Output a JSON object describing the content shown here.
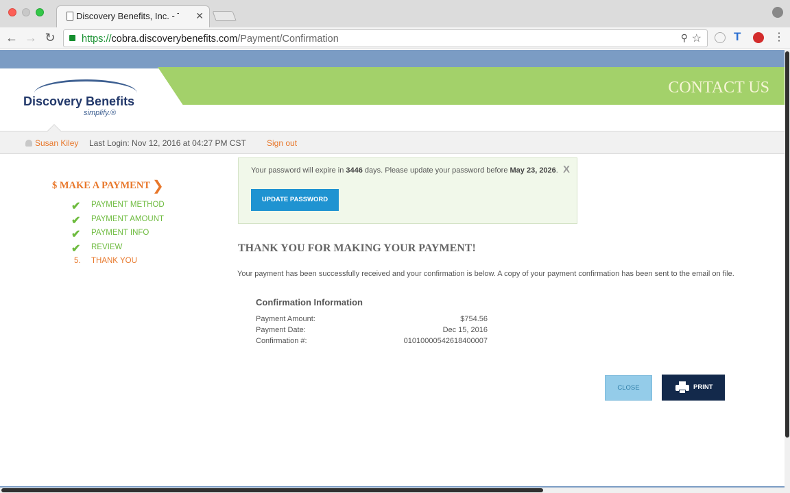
{
  "browser": {
    "tab_title": "Discovery Benefits, Inc. - Thank",
    "tab_close": "✕",
    "url_scheme": "https://",
    "url_host": "cobra.discoverybenefits.com",
    "url_path": "/Payment/Confirmation",
    "back_icon": "←",
    "forward_icon": "→",
    "reload_icon": "↻",
    "zoom_icon": "⚲",
    "star_icon": "☆",
    "menu_icon": "⋮",
    "ext_t": "T"
  },
  "header": {
    "logo_name": "Discovery Benefits",
    "logo_tagline": "simplify.®",
    "contact_label": "CONTACT US"
  },
  "userbar": {
    "user_name": "Susan Kiley",
    "last_login": "Last Login: Nov 12, 2016 at 04:27 PM CST",
    "sign_out": "Sign out"
  },
  "sidebar": {
    "title": "$ MAKE A PAYMENT",
    "chevron": "❯",
    "steps": [
      {
        "mark": "✔",
        "label": "Payment Method"
      },
      {
        "mark": "✔",
        "label": "Payment Amount"
      },
      {
        "mark": "✔",
        "label": "Payment Info"
      },
      {
        "mark": "✔",
        "label": "Review"
      },
      {
        "mark": "5.",
        "label": "Thank You"
      }
    ]
  },
  "notice": {
    "text_prefix": "Your password will expire in ",
    "days": "3446",
    "text_mid": " days. Please update your password before ",
    "date": "May 23, 2026",
    "text_suffix": ".",
    "close": "X",
    "button_label": "Update Password"
  },
  "main": {
    "heading": "THANK YOU FOR MAKING YOUR PAYMENT!",
    "message": "Your payment has been successfully received and your confirmation is below. A copy of your payment confirmation has been sent to the email on file.",
    "confirmation_title": "Confirmation Information",
    "rows": [
      {
        "key": "Payment Amount:",
        "value": "$754.56"
      },
      {
        "key": "Payment Date:",
        "value": "Dec 15, 2016"
      },
      {
        "key": "Confirmation #:",
        "value": "01010000542618400007"
      }
    ],
    "close_label": "Close",
    "print_label": "Print"
  },
  "colors": {
    "accent_orange": "#e8772a",
    "check_green": "#6dbb3e",
    "header_green": "#a3d16a",
    "navy": "#13294b",
    "button_blue": "#1f93d1"
  }
}
